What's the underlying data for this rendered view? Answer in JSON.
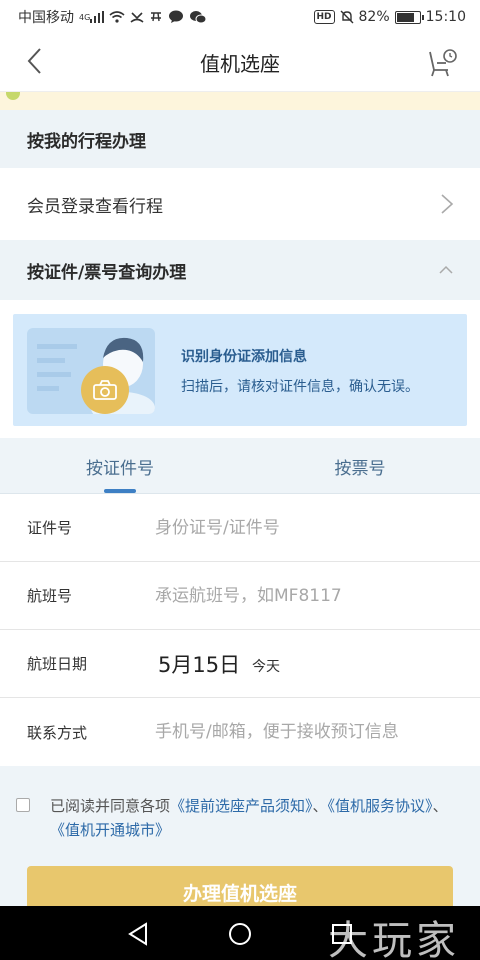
{
  "status_bar": {
    "carrier": "中国移动",
    "network": "4G",
    "battery": "82%",
    "battery_level": 0.82,
    "time": "15:10",
    "hd_badge": "HD"
  },
  "nav": {
    "title": "值机选座",
    "back_icon": "chevron-left-icon",
    "seat_icon": "seat-clock-icon"
  },
  "sections": {
    "by_itinerary": "按我的行程办理",
    "member_login": "会员登录查看行程",
    "by_certificate": "按证件/票号查询办理"
  },
  "id_card": {
    "title": "识别身份证添加信息",
    "subtitle": "扫描后，请核对证件信息，确认无误。"
  },
  "tabs": [
    {
      "label": "按证件号",
      "active": true
    },
    {
      "label": "按票号",
      "active": false
    }
  ],
  "form": {
    "id_label": "证件号",
    "id_placeholder": "身份证号/证件号",
    "flight_label": "航班号",
    "flight_placeholder": "承运航班号，如MF8117",
    "date_label": "航班日期",
    "date_value": "5月15日",
    "date_sub": "今天",
    "contact_label": "联系方式",
    "contact_placeholder": "手机号/邮箱，便于接收预订信息"
  },
  "agreement": {
    "prefix": "已阅读并同意各项",
    "link1": "《提前选座产品须知》",
    "sep1": "、",
    "link2": "《值机服务协议》",
    "sep2": "、",
    "link3": "《值机开通城市》"
  },
  "submit_label": "办理值机选座",
  "watermark": "大玩家",
  "colors": {
    "accent_blue": "#2d6aa8",
    "submit_gold": "#e8c76d",
    "section_bg": "#edf3f7"
  }
}
